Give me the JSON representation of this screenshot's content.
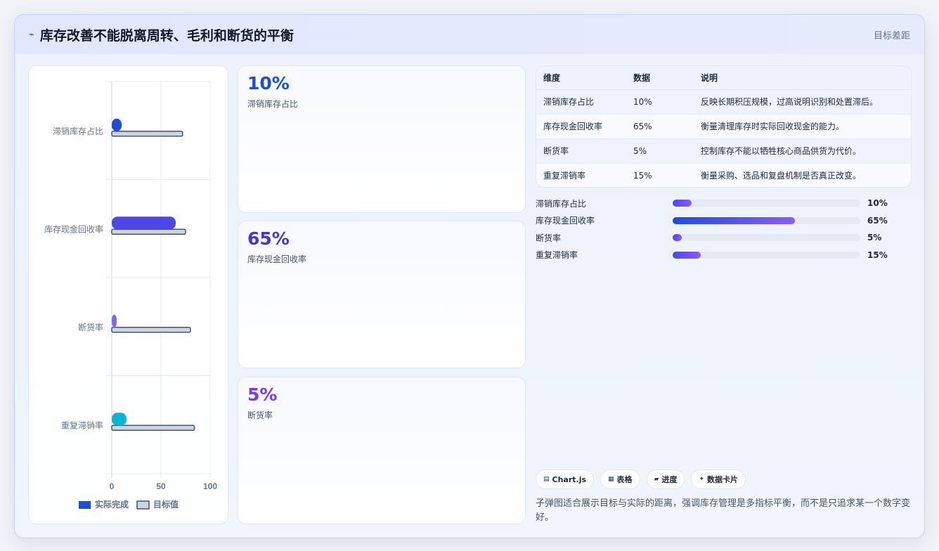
{
  "header": {
    "icon": "sparkline-icon",
    "title": "库存改善不能脱离周转、毛利和断货的平衡",
    "tag": "目标差距"
  },
  "chart_data": {
    "type": "bar",
    "orientation": "horizontal",
    "categories": [
      "滞销库存占比",
      "库存现金回收率",
      "断货率",
      "重复滞销率"
    ],
    "series": [
      {
        "name": "实际完成",
        "values": [
          10,
          65,
          5,
          15
        ],
        "colors": [
          "#1d4ed8",
          "#4f46e5",
          "#8b5cf6",
          "#06b6d4"
        ]
      },
      {
        "name": "目标值",
        "values": [
          72,
          75,
          80,
          84
        ],
        "color": "#cbd5e1"
      }
    ],
    "xticks": [
      "0",
      "50",
      "100"
    ],
    "xlim": [
      0,
      100
    ],
    "legend": "bottom"
  },
  "cards": [
    {
      "value": "10%",
      "label": "滞销库存占比",
      "color": "#1d4ed8"
    },
    {
      "value": "65%",
      "label": "库存现金回收率",
      "color": "#4338ca"
    },
    {
      "value": "5%",
      "label": "断货率",
      "color": "#7c3aed"
    }
  ],
  "table": {
    "headers": [
      "维度",
      "数据",
      "说明"
    ],
    "rows": [
      [
        "滞销库存占比",
        "10%",
        "反映长期积压规模，过高说明识别和处置滞后。"
      ],
      [
        "库存现金回收率",
        "65%",
        "衡量清理库存时实际回收现金的能力。"
      ],
      [
        "断货率",
        "5%",
        "控制库存不能以牺牲核心商品供货为代价。"
      ],
      [
        "重复滞销率",
        "15%",
        "衡量采购、选品和复盘机制是否真正改变。"
      ]
    ]
  },
  "progress": [
    {
      "label": "滞销库存占比",
      "value": "10%",
      "fraction": 0.1
    },
    {
      "label": "库存现金回收率",
      "value": "65%",
      "fraction": 0.65
    },
    {
      "label": "断货率",
      "value": "5%",
      "fraction": 0.05
    },
    {
      "label": "重复滞销率",
      "value": "15%",
      "fraction": 0.15
    }
  ],
  "chips": [
    {
      "icon": "▤",
      "label": "Chart.js"
    },
    {
      "icon": "▦",
      "label": "表格"
    },
    {
      "icon": "▰",
      "label": "进度"
    },
    {
      "icon": "✦",
      "label": "数据卡片"
    }
  ],
  "note": "子弹图适合展示目标与实际的距离，强调库存管理是多指标平衡，而不是只追求某一个数字变好。"
}
